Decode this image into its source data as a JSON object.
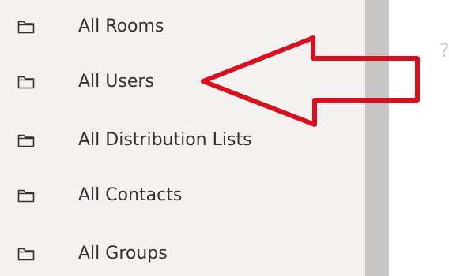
{
  "sidebar": {
    "items": [
      {
        "label": "All Rooms",
        "icon": "folder-icon"
      },
      {
        "label": "All Users",
        "icon": "folder-icon"
      },
      {
        "label": "All Distribution Lists",
        "icon": "folder-icon"
      },
      {
        "label": "All Contacts",
        "icon": "folder-icon"
      },
      {
        "label": "All Groups",
        "icon": "folder-icon"
      }
    ]
  },
  "edge_glyph": "?",
  "annotation": {
    "shape": "arrow-left",
    "color": "#d8101e"
  },
  "colors": {
    "sidebar_background": "#f3f2f1",
    "scrollbar": "#c8c6c4",
    "text": "#323130"
  }
}
